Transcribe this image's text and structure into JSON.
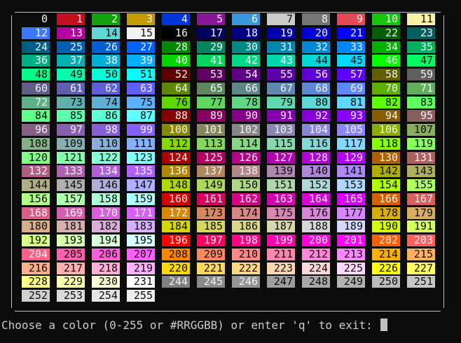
{
  "terminal": {
    "prompt": "Choose a color (0-255 or #RRGGBB) or enter 'q' to exit:"
  },
  "palette": {
    "colors": [
      "#0c0c0c",
      "#c50f1f",
      "#13a10e",
      "#c19c00",
      "#0037da",
      "#881798",
      "#3a96dd",
      "#cccccc",
      "#767676",
      "#e74856",
      "#16c60c",
      "#f9f1a5",
      "#3b78ff",
      "#b4009e",
      "#61d6d6",
      "#f2f2f2",
      "#000000",
      "#00005f",
      "#000087",
      "#0000af",
      "#0000d7",
      "#0000ff",
      "#005f00",
      "#005f5f",
      "#005f87",
      "#005faf",
      "#005fd7",
      "#005fff",
      "#008700",
      "#00875f",
      "#008787",
      "#0087af",
      "#0087d7",
      "#0087ff",
      "#00af00",
      "#00af5f",
      "#00af87",
      "#00afaf",
      "#00afd7",
      "#00afff",
      "#00d700",
      "#00d75f",
      "#00d787",
      "#00d7af",
      "#00d7d7",
      "#00d7ff",
      "#00ff00",
      "#00ff5f",
      "#00ff87",
      "#00ffaf",
      "#00ffd7",
      "#00ffff",
      "#5f0000",
      "#5f005f",
      "#5f0087",
      "#5f00af",
      "#5f00d7",
      "#5f00ff",
      "#5f5f00",
      "#5f5f5f",
      "#5f5f87",
      "#5f5faf",
      "#5f5fd7",
      "#5f5fff",
      "#5f8700",
      "#5f875f",
      "#5f8787",
      "#5f87af",
      "#5f87d7",
      "#5f87ff",
      "#5faf00",
      "#5faf5f",
      "#5faf87",
      "#5fafaf",
      "#5fafd7",
      "#5fafff",
      "#5fd700",
      "#5fd75f",
      "#5fd787",
      "#5fd7af",
      "#5fd7d7",
      "#5fd7ff",
      "#5fff00",
      "#5fff5f",
      "#5fff87",
      "#5fffaf",
      "#5fffd7",
      "#5fffff",
      "#870000",
      "#87005f",
      "#870087",
      "#8700af",
      "#8700d7",
      "#8700ff",
      "#875f00",
      "#875f5f",
      "#875f87",
      "#875faf",
      "#875fd7",
      "#875fff",
      "#878700",
      "#87875f",
      "#878787",
      "#8787af",
      "#8787d7",
      "#8787ff",
      "#87af00",
      "#87af5f",
      "#87af87",
      "#87afaf",
      "#87afd7",
      "#87afff",
      "#87d700",
      "#87d75f",
      "#87d787",
      "#87d7af",
      "#87d7d7",
      "#87d7ff",
      "#87ff00",
      "#87ff5f",
      "#87ff87",
      "#87ffaf",
      "#87ffd7",
      "#87ffff",
      "#af0000",
      "#af005f",
      "#af0087",
      "#af00af",
      "#af00d7",
      "#af00ff",
      "#af5f00",
      "#af5f5f",
      "#af5f87",
      "#af5faf",
      "#af5fd7",
      "#af5fff",
      "#af8700",
      "#af875f",
      "#af8787",
      "#af87af",
      "#af87d7",
      "#af87ff",
      "#afaf00",
      "#afaf5f",
      "#afaf87",
      "#afafaf",
      "#afafd7",
      "#afafff",
      "#afd700",
      "#afd75f",
      "#afd787",
      "#afd7af",
      "#afd7d7",
      "#afd7ff",
      "#afff00",
      "#afff5f",
      "#afff87",
      "#afffaf",
      "#afffd7",
      "#afffff",
      "#d70000",
      "#d7005f",
      "#d70087",
      "#d700af",
      "#d700d7",
      "#d700ff",
      "#d75f00",
      "#d75f5f",
      "#d75f87",
      "#d75faf",
      "#d75fd7",
      "#d75fff",
      "#d78700",
      "#d7875f",
      "#d78787",
      "#d787af",
      "#d787d7",
      "#d787ff",
      "#d7af00",
      "#d7af5f",
      "#d7af87",
      "#d7afaf",
      "#d7afd7",
      "#d7afff",
      "#d7d700",
      "#d7d75f",
      "#d7d787",
      "#d7d7af",
      "#d7d7d7",
      "#d7d7ff",
      "#d7ff00",
      "#d7ff5f",
      "#d7ff87",
      "#d7ffaf",
      "#d7ffd7",
      "#d7ffff",
      "#ff0000",
      "#ff005f",
      "#ff0087",
      "#ff00af",
      "#ff00d7",
      "#ff00ff",
      "#ff5f00",
      "#ff5f5f",
      "#ff5f87",
      "#ff5faf",
      "#ff5fd7",
      "#ff5fff",
      "#ff8700",
      "#ff875f",
      "#ff8787",
      "#ff87af",
      "#ff87d7",
      "#ff87ff",
      "#ffaf00",
      "#ffaf5f",
      "#ffaf87",
      "#ffafaf",
      "#ffafd7",
      "#ffafff",
      "#ffd700",
      "#ffd75f",
      "#ffd787",
      "#ffd7af",
      "#ffd7d7",
      "#ffd7ff",
      "#ffff00",
      "#ffff5f",
      "#ffff87",
      "#ffffaf",
      "#ffffd7",
      "#ffffff",
      "#080808",
      "#121212",
      "#1c1c1c",
      "#262626",
      "#303030",
      "#3a3a3a",
      "#444444",
      "#4e4e4e",
      "#585858",
      "#626262",
      "#6c6c6c",
      "#767676",
      "#808080",
      "#8a8a8a",
      "#949494",
      "#9e9e9e",
      "#a8a8a8",
      "#b2b2b2",
      "#bcbcbc",
      "#c6c6c6",
      "#d0d0d0",
      "#dadada",
      "#e4e4e4",
      "#eeeeee"
    ],
    "text_colors": {
      "light": "#f2f2f2",
      "dark": "#0c0c0c"
    },
    "frame_color": "#c0c0c0"
  }
}
